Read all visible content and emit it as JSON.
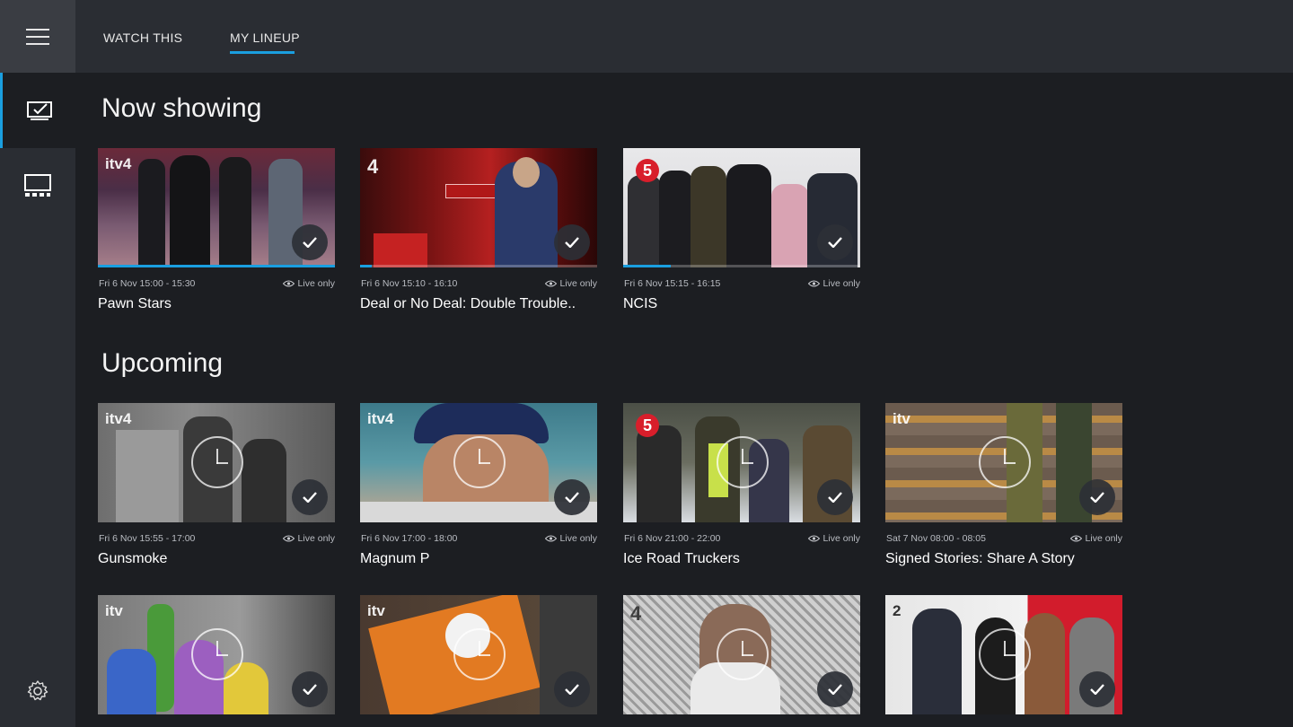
{
  "nav": {
    "tabs": [
      {
        "label": "WATCH THIS"
      },
      {
        "label": "MY LINEUP",
        "active": true
      }
    ],
    "accent": "#1a9fe0"
  },
  "sections": {
    "now_showing": "Now showing",
    "upcoming": "Upcoming"
  },
  "now_showing": [
    {
      "time": "Fri 6 Nov 15:00 - 15:30",
      "live": "Live only",
      "title": "Pawn Stars",
      "channel": "itv4",
      "progress": 1.0
    },
    {
      "time": "Fri 6 Nov 15:10 - 16:10",
      "live": "Live only",
      "title": "Deal or No Deal: Double Trouble..",
      "channel": "4",
      "progress": 0.05
    },
    {
      "time": "Fri 6 Nov 15:15 - 16:15",
      "live": "Live only",
      "title": "NCIS",
      "channel": "5",
      "progress": 0.2
    }
  ],
  "upcoming": [
    {
      "time": "Fri 6 Nov 15:55 - 17:00",
      "live": "Live only",
      "title": "Gunsmoke",
      "channel": "itv4"
    },
    {
      "time": "Fri 6 Nov 17:00 - 18:00",
      "live": "Live only",
      "title": "Magnum P",
      "channel": "itv4"
    },
    {
      "time": "Fri 6 Nov 21:00 - 22:00",
      "live": "Live only",
      "title": "Ice Road Truckers",
      "channel": "5"
    },
    {
      "time": "Sat 7 Nov 08:00 - 08:05",
      "live": "Live only",
      "title": "Signed Stories: Share A Story",
      "channel": "itv"
    }
  ],
  "upcoming_row2": [
    {
      "channel": "itv"
    },
    {
      "channel": "itv"
    },
    {
      "channel": "4"
    },
    {
      "channel": "2"
    }
  ]
}
